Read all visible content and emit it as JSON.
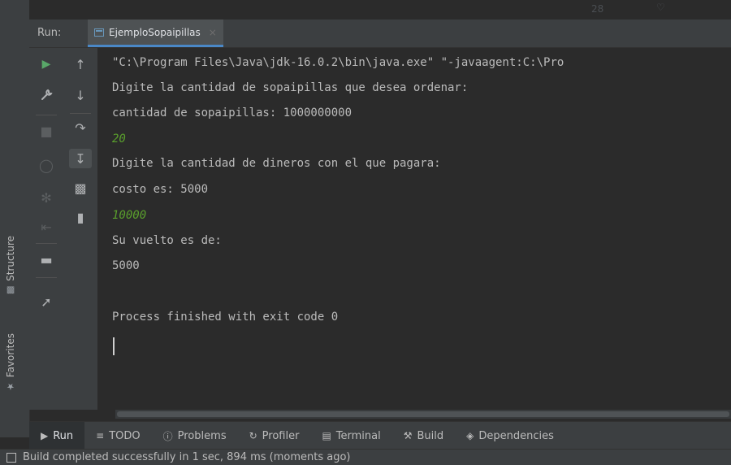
{
  "top_ghost": [
    "28",
    "♡"
  ],
  "left_stripe": {
    "structure_label": "Structure",
    "favorites_label": "Favorites"
  },
  "run_panel": {
    "label": "Run:",
    "tab_title": "EjemploSopaipillas",
    "tab_close": "×"
  },
  "console": {
    "lines": [
      {
        "text": "\"C:\\Program Files\\Java\\jdk-16.0.2\\bin\\java.exe\" \"-javaagent:C:\\Pro",
        "type": "output"
      },
      {
        "text": "Digite la cantidad de sopaipillas que desea ordenar:",
        "type": "output"
      },
      {
        "text": "cantidad de sopaipillas: 1000000000",
        "type": "output"
      },
      {
        "text": "20",
        "type": "input"
      },
      {
        "text": "Digite la cantidad de dineros con el que pagara:",
        "type": "output"
      },
      {
        "text": "costo es: 5000",
        "type": "output"
      },
      {
        "text": "10000",
        "type": "input"
      },
      {
        "text": "Su vuelto es de:",
        "type": "output"
      },
      {
        "text": "5000",
        "type": "output"
      },
      {
        "text": "",
        "type": "output"
      },
      {
        "text": "Process finished with exit code 0",
        "type": "output"
      }
    ]
  },
  "bottom_tabs": [
    {
      "icon": "▶",
      "label": "Run",
      "active": true
    },
    {
      "icon": "≡",
      "label": "TODO",
      "active": false
    },
    {
      "icon": "ⓘ",
      "label": "Problems",
      "active": false
    },
    {
      "icon": "↻",
      "label": "Profiler",
      "active": false
    },
    {
      "icon": "▤",
      "label": "Terminal",
      "active": false
    },
    {
      "icon": "⚒",
      "label": "Build",
      "active": false
    },
    {
      "icon": "◈",
      "label": "Dependencies",
      "active": false
    }
  ],
  "status": {
    "text": "Build completed successfully in 1 sec, 894 ms (moments ago)"
  },
  "colors": {
    "panel": "#3c3f41",
    "editor": "#2b2b2b",
    "input_text": "#5aa02c",
    "run_green": "#59a869",
    "tab_underline": "#4a88c7"
  }
}
